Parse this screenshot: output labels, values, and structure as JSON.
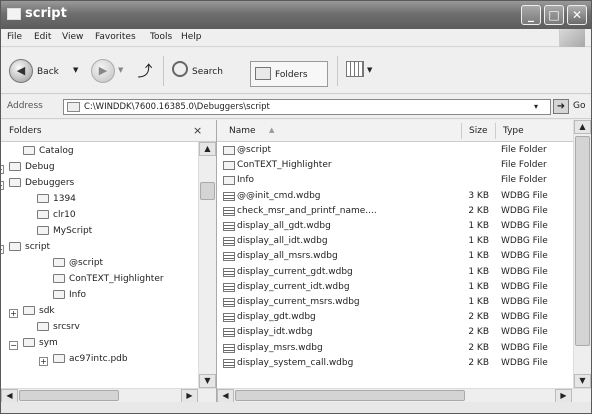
{
  "window": {
    "title": "script"
  },
  "menu": [
    "File",
    "Edit",
    "View",
    "Favorites",
    "Tools",
    "Help"
  ],
  "toolbar": {
    "back": "Back",
    "search": "Search",
    "folders": "Folders"
  },
  "address": {
    "label": "Address",
    "path": "C:\\WINDDK\\7600.16385.0\\Debuggers\\script",
    "go": "Go"
  },
  "folders_pane": {
    "header": "Folders",
    "close": "×",
    "tree": [
      {
        "label": "Catalog",
        "expander": ""
      },
      {
        "label": "Debug",
        "expander": "+"
      },
      {
        "label": "Debuggers",
        "expander": "−"
      },
      {
        "label": "1394",
        "expander": ""
      },
      {
        "label": "clr10",
        "expander": ""
      },
      {
        "label": "MyScript",
        "expander": ""
      },
      {
        "label": "script",
        "expander": "−"
      },
      {
        "label": "@script",
        "expander": ""
      },
      {
        "label": "ConTEXT_Highlighter",
        "expander": ""
      },
      {
        "label": "Info",
        "expander": ""
      },
      {
        "label": "sdk",
        "expander": "+"
      },
      {
        "label": "srcsrv",
        "expander": ""
      },
      {
        "label": "sym",
        "expander": "−"
      },
      {
        "label": "ac97intc.pdb",
        "expander": "+"
      }
    ]
  },
  "columns": {
    "name": "Name",
    "size": "Size",
    "type": "Type",
    "sort_indicator": "▲"
  },
  "files": [
    {
      "name": "@script",
      "size": "",
      "type": "File Folder",
      "kind": "folder"
    },
    {
      "name": "ConTEXT_Highlighter",
      "size": "",
      "type": "File Folder",
      "kind": "folder"
    },
    {
      "name": "Info",
      "size": "",
      "type": "File Folder",
      "kind": "folder"
    },
    {
      "name": "@@init_cmd.wdbg",
      "size": "3 KB",
      "type": "WDBG File",
      "kind": "file"
    },
    {
      "name": "check_msr_and_printf_name....",
      "size": "2 KB",
      "type": "WDBG File",
      "kind": "file"
    },
    {
      "name": "display_all_gdt.wdbg",
      "size": "1 KB",
      "type": "WDBG File",
      "kind": "file"
    },
    {
      "name": "display_all_idt.wdbg",
      "size": "1 KB",
      "type": "WDBG File",
      "kind": "file"
    },
    {
      "name": "display_all_msrs.wdbg",
      "size": "1 KB",
      "type": "WDBG File",
      "kind": "file"
    },
    {
      "name": "display_current_gdt.wdbg",
      "size": "1 KB",
      "type": "WDBG File",
      "kind": "file"
    },
    {
      "name": "display_current_idt.wdbg",
      "size": "1 KB",
      "type": "WDBG File",
      "kind": "file"
    },
    {
      "name": "display_current_msrs.wdbg",
      "size": "1 KB",
      "type": "WDBG File",
      "kind": "file"
    },
    {
      "name": "display_gdt.wdbg",
      "size": "2 KB",
      "type": "WDBG File",
      "kind": "file"
    },
    {
      "name": "display_idt.wdbg",
      "size": "2 KB",
      "type": "WDBG File",
      "kind": "file"
    },
    {
      "name": "display_msrs.wdbg",
      "size": "2 KB",
      "type": "WDBG File",
      "kind": "file"
    },
    {
      "name": "display_system_call.wdbg",
      "size": "2 KB",
      "type": "WDBG File",
      "kind": "file"
    }
  ]
}
